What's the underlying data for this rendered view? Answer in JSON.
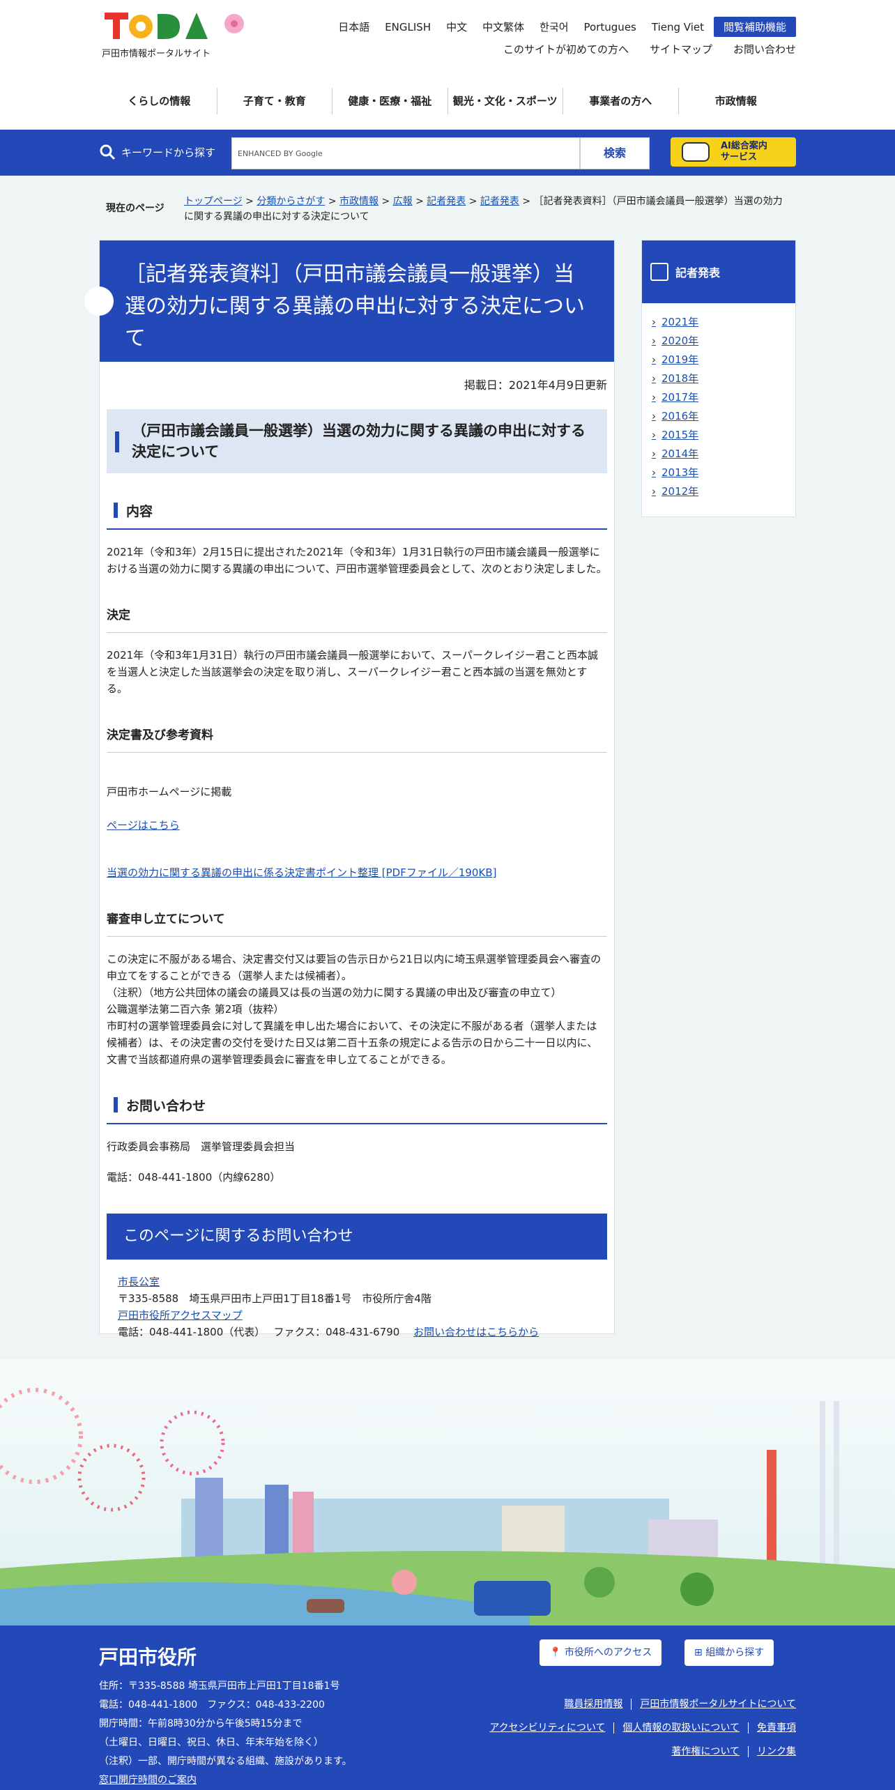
{
  "header": {
    "logo_sub": "戸田市情報ポータルサイト",
    "languages": [
      "日本語",
      "ENGLISH",
      "中文",
      "中文繁体",
      "한국어",
      "Portugues",
      "Tieng Viet"
    ],
    "assist": "閲覧補助機能",
    "util": [
      "このサイトが初めての方へ",
      "サイトマップ",
      "お問い合わせ"
    ],
    "gnav": [
      "くらしの情報",
      "子育て・教育",
      "健康・医療・福祉",
      "観光・文化・スポーツ",
      "事業者の方へ",
      "市政情報"
    ]
  },
  "search": {
    "label": "キーワードから探す",
    "placeholder": "ENHANCED BY Google",
    "button": "検索",
    "ai_line1": "AI総合案内",
    "ai_line2": "サービス"
  },
  "breadcrumb": {
    "label": "現在のページ",
    "links": [
      "トップページ",
      "分類からさがす",
      "市政情報",
      "広報",
      "記者発表",
      "記者発表"
    ],
    "current": "［記者発表資料］（戸田市議会議員一般選挙）当選の効力に関する異議の申出に対する決定について"
  },
  "article": {
    "title": "［記者発表資料］（戸田市議会議員一般選挙）当選の効力に関する異議の申出に対する決定について",
    "date": "掲載日：2021年4月9日更新",
    "h2": "（戸田市議会議員一般選挙）当選の効力に関する異議の申出に対する決定について",
    "s1_title": "内容",
    "s1_text": "2021年（令和3年）2月15日に提出された2021年（令和3年）1月31日執行の戸田市議会議員一般選挙における当選の効力に関する異議の申出について、戸田市選挙管理委員会として、次のとおり決定しました。",
    "s2_title": "決定",
    "s2_text": "2021年（令和3年1月31日）執行の戸田市議会議員一般選挙において、スーパークレイジー君こと西本誠を当選人と決定した当該選挙会の決定を取り消し、スーパークレイジー君こと西本誠の当選を無効とする。",
    "s3_title": "決定書及び参考資料",
    "s3_text": "戸田市ホームページに掲載",
    "s3_link1": "ページはこちら",
    "s3_link2": "当選の効力に関する異議の申出に係る決定書ポイント整理 [PDFファイル／190KB]",
    "s4_title": "審査申し立てについて",
    "s4_text": "この決定に不服がある場合、決定書交付又は要旨の告示日から21日以内に埼玉県選挙管理委員会へ審査の申立てをすることができる（選挙人または候補者）。\n（注釈）（地方公共団体の議会の議員又は長の当選の効力に関する異議の申出及び審査の申立て）\n公職選挙法第二百六条 第2項（抜粋）\n市町村の選挙管理委員会に対して異議を申し出た場合において、その決定に不服がある者（選挙人または候補者）は、その決定書の交付を受けた日又は第二百十五条の規定による告示の日から二十一日以内に、文書で当該都道府県の選挙管理委員会に審査を申し立てることができる。",
    "s5_title": "お問い合わせ",
    "s5_dept": "行政委員会事務局　選挙管理委員会担当",
    "s5_tel": "電話：048-441-1800（内線6280）"
  },
  "contact": {
    "heading": "このページに関するお問い合わせ",
    "office": "市長公室",
    "address": "〒335-8588　埼玉県戸田市上戸田1丁目18番1号　市役所庁舎4階",
    "map_link": "戸田市役所アクセスマップ",
    "tel": "電話：048-441-1800（代表）　 ファクス：048-431-6790",
    "form_link": "お問い合わせはこちらから"
  },
  "sidebar": {
    "title": "記者発表",
    "years": [
      "2021年",
      "2020年",
      "2019年",
      "2018年",
      "2017年",
      "2016年",
      "2015年",
      "2014年",
      "2013年",
      "2012年"
    ]
  },
  "footer": {
    "title": "戸田市役所",
    "info": "住所：〒335-8588 埼玉県戸田市上戸田1丁目18番1号\n電話：048-441-1800　ファクス：048-433-2200\n開庁時間：午前8時30分から午後5時15分まで\n（土曜日、日曜日、祝日、休日、年末年始を除く）\n（注釈）一部、開庁時間が異なる組織、施設があります。",
    "hours_link": "窓口開庁時間のご案内",
    "access_btn": "市役所へのアクセス",
    "org_btn": "組織から探す",
    "links_row1": [
      "職員採用情報",
      "戸田市情報ポータルサイトについて"
    ],
    "links_row2": [
      "アクセシビリティについて",
      "個人情報の取扱いについて",
      "免責事項"
    ],
    "links_row3": [
      "著作権について",
      "リンク集"
    ]
  },
  "colors": {
    "primary": "#2348b8",
    "accent": "#f7d21a",
    "bg": "#eef5f4"
  }
}
